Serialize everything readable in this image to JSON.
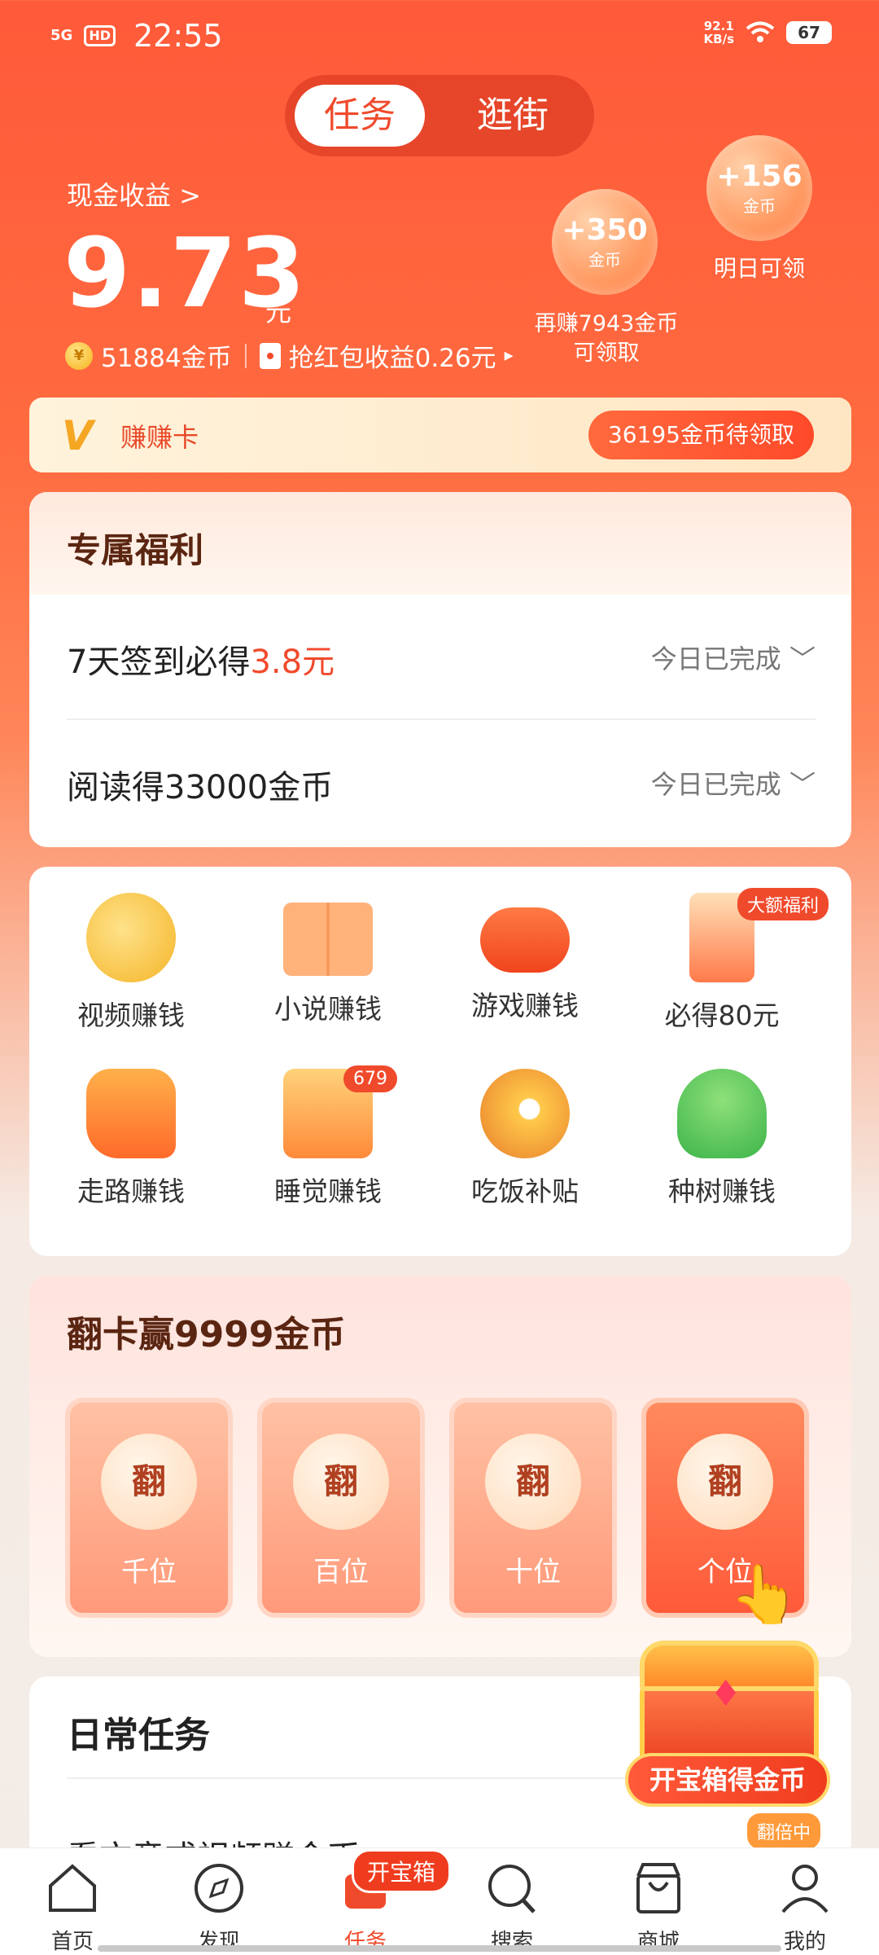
{
  "status": {
    "net": "5G",
    "hd": "HD",
    "time": "22:55",
    "speed_value": "92.1",
    "speed_unit": "KB/s",
    "battery": "67"
  },
  "top_tabs": {
    "task": "任务",
    "shop": "逛街"
  },
  "earnings": {
    "label": "现金收益 >",
    "amount": "9.73",
    "unit": "元",
    "coins": "51884金币",
    "redpacket": "抢红包收益0.26元"
  },
  "bubbles": [
    {
      "amount": "+350",
      "unit": "金币",
      "caption_line1": "再赚7943金币",
      "caption_line2": "可领取"
    },
    {
      "amount": "+156",
      "unit": "金币",
      "caption": "明日可领"
    }
  ],
  "zhuan_card": {
    "logo": "V",
    "label": "赚赚卡",
    "button": "36195金币待领取"
  },
  "exclusive": {
    "title": "专属福利",
    "rows": [
      {
        "label_prefix": "7天签到必得",
        "label_highlight": "3.8元",
        "status": "今日已完成"
      },
      {
        "label_prefix": "阅读得33000金币",
        "label_highlight": "",
        "status": "今日已完成"
      }
    ]
  },
  "grid": {
    "items": [
      {
        "label": "视频赚钱",
        "icon": "coin-video-icon"
      },
      {
        "label": "小说赚钱",
        "icon": "book-icon"
      },
      {
        "label": "游戏赚钱",
        "icon": "gamepad-icon"
      },
      {
        "label": "必得80元",
        "icon": "money-stack-icon",
        "badge": "大额福利"
      },
      {
        "label": "走路赚钱",
        "icon": "shoe-icon"
      },
      {
        "label": "睡觉赚钱",
        "icon": "bed-icon",
        "badge": "679"
      },
      {
        "label": "吃饭补贴",
        "icon": "food-bowl-icon"
      },
      {
        "label": "种树赚钱",
        "icon": "money-tree-icon"
      }
    ]
  },
  "flip": {
    "title": "翻卡赢9999金币",
    "cards": [
      {
        "char": "翻",
        "pos": "千位"
      },
      {
        "char": "翻",
        "pos": "百位"
      },
      {
        "char": "翻",
        "pos": "十位"
      },
      {
        "char": "翻",
        "pos": "个位"
      }
    ]
  },
  "daily": {
    "title": "日常任务",
    "next_item": "看文章或视频赚金币"
  },
  "treasure": {
    "button": "开宝箱得金币",
    "double_badge": "翻倍中"
  },
  "bottom_nav": {
    "items": [
      {
        "label": "首页",
        "icon": "home-icon"
      },
      {
        "label": "发现",
        "icon": "compass-icon"
      },
      {
        "label": "任务",
        "icon": "task-gift-icon"
      },
      {
        "label": "搜索",
        "icon": "search-icon"
      },
      {
        "label": "商城",
        "icon": "shopping-bag-icon"
      },
      {
        "label": "我的",
        "icon": "person-icon"
      }
    ],
    "badge": "开宝箱"
  },
  "colors": {
    "accent": "#f04a2c",
    "brown_title": "#5a2511",
    "gold": "#f5a623"
  }
}
